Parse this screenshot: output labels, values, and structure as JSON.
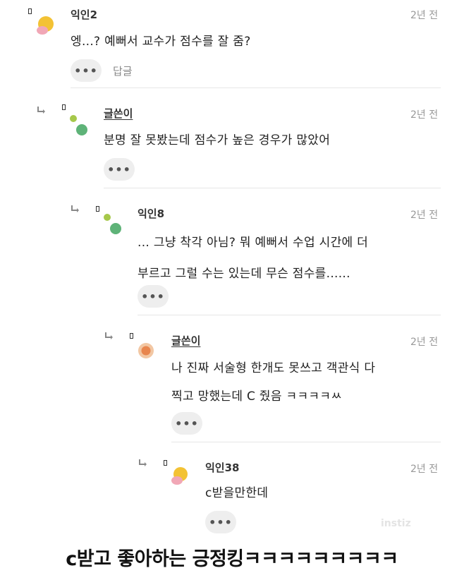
{
  "comments": [
    {
      "author": "익인2",
      "time": "2년 전",
      "lines": [
        "엥...? 예뻐서 교수가 점수를 잘 줌?"
      ],
      "more": "•••",
      "reply": "답글"
    },
    {
      "author": "글쓴이",
      "time": "2년 전",
      "lines": [
        "분명 잘 못봤는데 점수가 높은 경우가 많았어"
      ],
      "more": "•••"
    },
    {
      "author": "익인8",
      "time": "2년 전",
      "lines": [
        "... 그냥 착각 아님? 뭐 예뻐서 수업 시간에 더",
        "부르고 그럴 수는 있는데 무슨 점수를......"
      ],
      "more": "•••"
    },
    {
      "author": "글쓴이",
      "time": "2년 전",
      "lines": [
        "나 진짜 서술형 한개도 못쓰고 객관식 다",
        "찍고 망했는데 C 줬음 ㅋㅋㅋㅋㅆ"
      ],
      "more": "•••"
    },
    {
      "author": "익인38",
      "time": "2년 전",
      "lines": [
        "c받을만한데"
      ],
      "more": "•••"
    }
  ],
  "caption": "c받고 좋아하는 긍정킹ㅋㅋㅋㅋㅋㅋㅋㅋㅋ",
  "watermark": "instiz"
}
